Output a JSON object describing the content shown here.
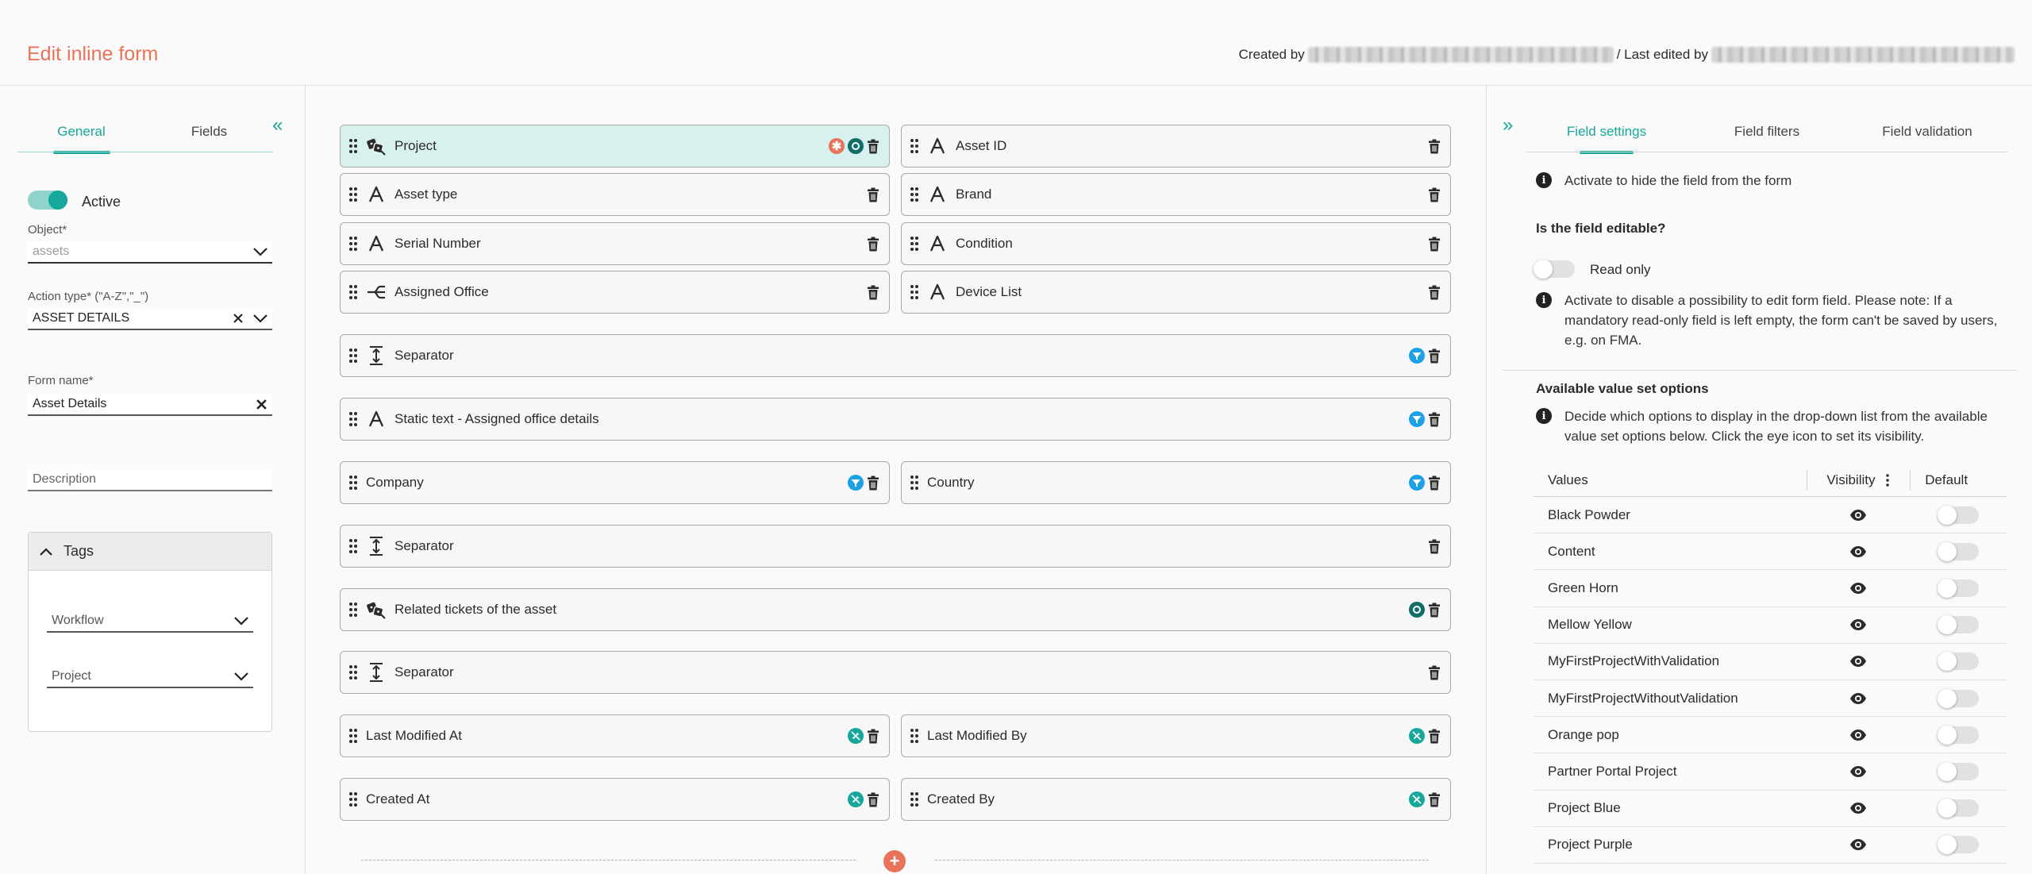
{
  "header": {
    "title": "Edit inline form",
    "created_by_label": "Created by",
    "last_edited_by_label": "/ Last edited by"
  },
  "left_panel": {
    "tabs": [
      "General",
      "Fields"
    ],
    "active_tab": "General",
    "active_label": "Active",
    "object_label": "Object*",
    "object_value": "assets",
    "action_type_label": "Action type* (\"A-Z\",\"_\")",
    "action_type_value": "ASSET DETAILS",
    "form_name_label": "Form name*",
    "form_name_value": "Asset Details",
    "description_placeholder": "Description",
    "tags_label": "Tags",
    "workflow_placeholder": "Workflow",
    "project_placeholder": "Project"
  },
  "fields": [
    {
      "name": "Project",
      "type_icon": "lookup-icon",
      "actions": [
        "required-icon",
        "record-icon",
        "trash-icon"
      ],
      "selected": true
    },
    {
      "name": "Asset ID",
      "type_icon": "text-icon",
      "actions": [
        "trash-icon"
      ]
    },
    {
      "name": "Asset type",
      "type_icon": "text-icon",
      "actions": [
        "trash-icon"
      ]
    },
    {
      "name": "Brand",
      "type_icon": "text-icon",
      "actions": [
        "trash-icon"
      ]
    },
    {
      "name": "Serial Number",
      "type_icon": "text-icon",
      "actions": [
        "trash-icon"
      ]
    },
    {
      "name": "Condition",
      "type_icon": "text-icon",
      "actions": [
        "trash-icon"
      ]
    },
    {
      "name": "Assigned Office",
      "type_icon": "tree-icon",
      "actions": [
        "trash-icon"
      ]
    },
    {
      "name": "Device List",
      "type_icon": "text-icon",
      "actions": [
        "trash-icon"
      ]
    },
    {
      "name": "Separator",
      "type_icon": "separator-icon",
      "actions": [
        "filter-icon",
        "trash-icon"
      ]
    },
    {
      "name": "Static text - Assigned office details",
      "type_icon": "text-icon",
      "actions": [
        "filter-icon",
        "trash-icon"
      ]
    },
    {
      "name": "Company",
      "type_icon": "",
      "actions": [
        "filter-icon",
        "trash-icon"
      ]
    },
    {
      "name": "Country",
      "type_icon": "",
      "actions": [
        "filter-icon",
        "trash-icon"
      ]
    },
    {
      "name": "Separator",
      "type_icon": "separator-icon",
      "actions": [
        "trash-icon"
      ]
    },
    {
      "name": "Related tickets of the asset",
      "type_icon": "lookup-icon",
      "actions": [
        "record-icon",
        "trash-icon"
      ]
    },
    {
      "name": "Separator",
      "type_icon": "separator-icon",
      "actions": [
        "trash-icon"
      ]
    },
    {
      "name": "Last Modified At",
      "type_icon": "",
      "actions": [
        "readonly-icon",
        "trash-icon"
      ]
    },
    {
      "name": "Last Modified By",
      "type_icon": "",
      "actions": [
        "readonly-icon",
        "trash-icon"
      ]
    },
    {
      "name": "Created At",
      "type_icon": "",
      "actions": [
        "readonly-icon",
        "trash-icon"
      ]
    },
    {
      "name": "Created By",
      "type_icon": "",
      "actions": [
        "readonly-icon",
        "trash-icon"
      ]
    }
  ],
  "right_panel": {
    "tabs": [
      "Field settings",
      "Field filters",
      "Field validation"
    ],
    "active_tab": "Field settings",
    "hide_info": "Activate to hide the field from the form",
    "editable_title": "Is the field editable?",
    "read_only_label": "Read only",
    "read_only_info": "Activate to disable a possibility to edit form field. Please note: If a mandatory read-only field is left empty, the form can't be saved by users, e.g. on FMA.",
    "value_set_title": "Available value set options",
    "value_set_info": "Decide which options to display in the drop-down list from the available value set options below. Click the eye icon to set its visibility.",
    "table_headers": [
      "Values",
      "Visibility",
      "Default"
    ],
    "values": [
      "Black Powder",
      "Content",
      "Green Horn",
      "Mellow Yellow",
      "MyFirstProjectWithValidation",
      "MyFirstProjectWithoutValidation",
      "Orange pop",
      "Partner Portal Project",
      "Project Blue",
      "Project Purple"
    ]
  },
  "colors": {
    "accent": "#16a89a",
    "title": "#e8735a",
    "required": "#e8735a",
    "filter": "#1da1e6",
    "record": "#0f6e66",
    "readonly": "#16a89a"
  }
}
